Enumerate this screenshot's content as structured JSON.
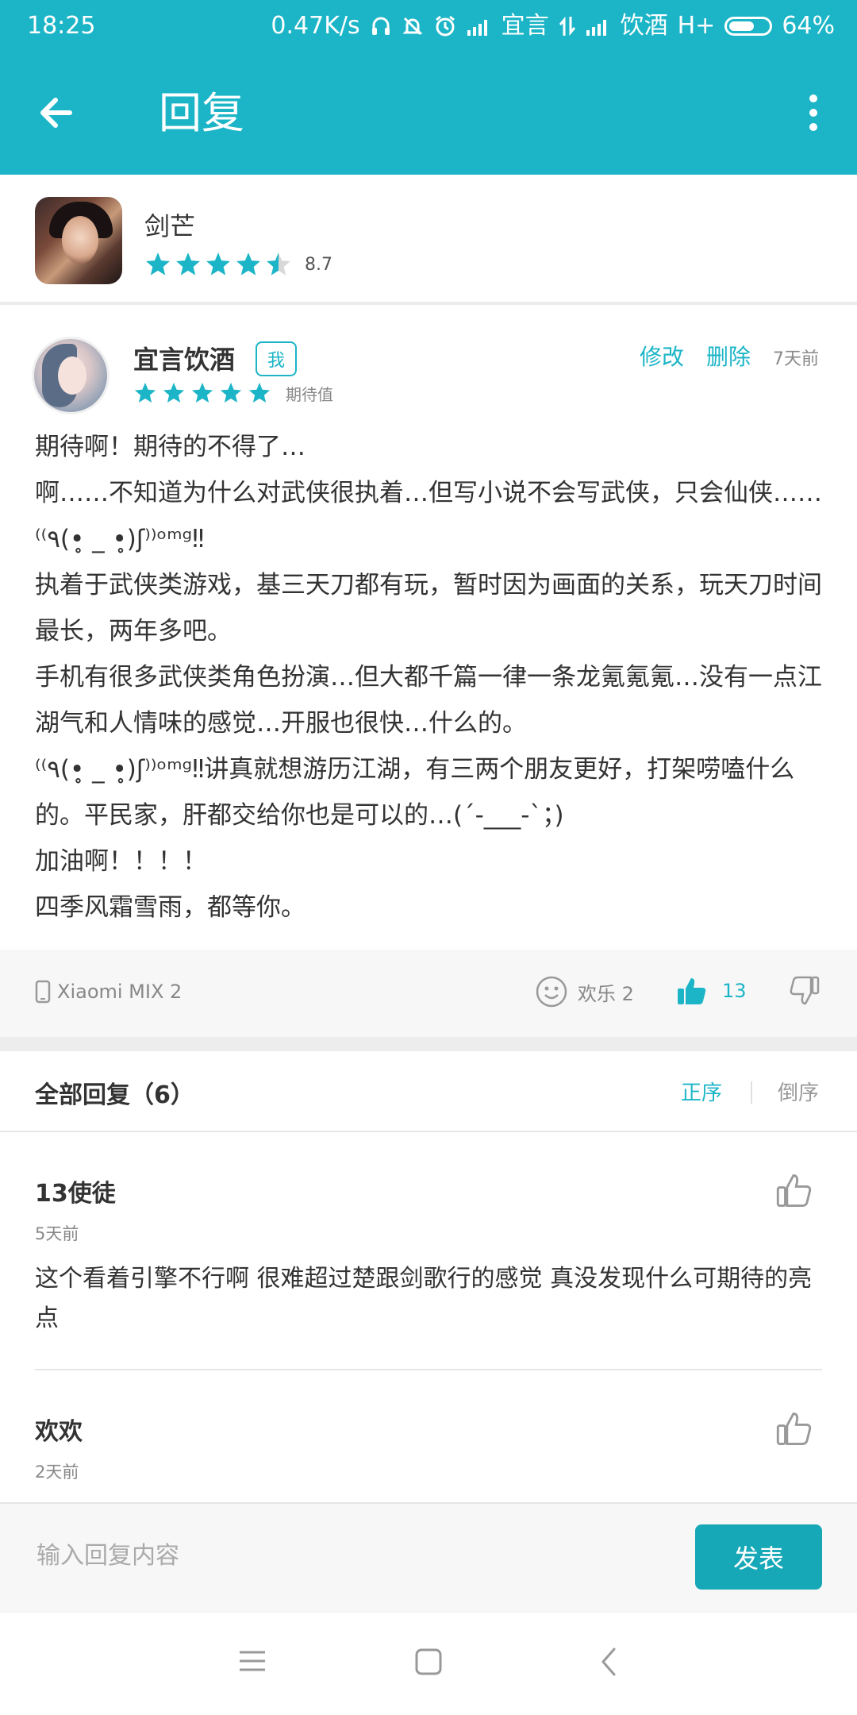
{
  "status_bar": {
    "time": "18:25",
    "net_speed": "0.47K/s",
    "carrier1": "宜言",
    "carrier2": "饮酒",
    "network": "H+",
    "battery": "64%",
    "battery_level": 0.64
  },
  "app_bar": {
    "title": "回复"
  },
  "game": {
    "name": "剑芒",
    "score": "8.7",
    "rating_stars": 4.5
  },
  "comment": {
    "user": "宜言饮酒",
    "me_badge": "我",
    "stars_label": "期待值",
    "rating_stars": 5,
    "edit_label": "修改",
    "delete_label": "删除",
    "time": "7天前",
    "lines": [
      "期待啊！期待的不得了…",
      "啊……不知道为什么对武侠很执着…但写小说不会写武侠，只会仙侠……⁽⁽٩(•̥ _ •̥)ʃ⁾⁾ᵒᵐᵍ‼",
      "执着于武侠类游戏，基三天刀都有玩，暂时因为画面的关系，玩天刀时间最长，两年多吧。",
      "手机有很多武侠类角色扮演…但大都千篇一律一条龙氪氪氪…没有一点江湖气和人情味的感觉…开服也很快…什么的。",
      "⁽⁽٩(•̥ _ •̥)ʃ⁾⁾ᵒᵐᵍ‼讲真就想游历江湖，有三两个朋友更好，打架唠嗑什么的。平民家，肝都交给你也是可以的…(´-___-`；)",
      "加油啊！！！！",
      "四季风霜雪雨，都等你。"
    ],
    "device": "Xiaomi MIX 2",
    "fun_label": "欢乐 2",
    "like_count": "13"
  },
  "replies_section": {
    "title": "全部回复（6）",
    "sort_asc": "正序",
    "sort_desc": "倒序",
    "items": [
      {
        "user": "13使徒",
        "time": "5天前",
        "text": "这个看着引擎不行啊 很难超过楚跟剑歌行的感觉 真没发现什么可期待的亮点"
      },
      {
        "user": "欢欢",
        "time": "2天前",
        "text": ""
      }
    ]
  },
  "input_bar": {
    "placeholder": "输入回复内容",
    "value": "",
    "send_label": "发表"
  },
  "colors": {
    "accent": "#1cb5c7",
    "send_button": "#17a8b7"
  },
  "icons": {
    "back": "arrow-left-icon",
    "more": "more-vertical-icon",
    "star": "star-icon",
    "phone": "phone-icon",
    "fun": "smiley-icon",
    "like": "thumbs-up-icon",
    "dislike": "thumbs-down-icon"
  }
}
